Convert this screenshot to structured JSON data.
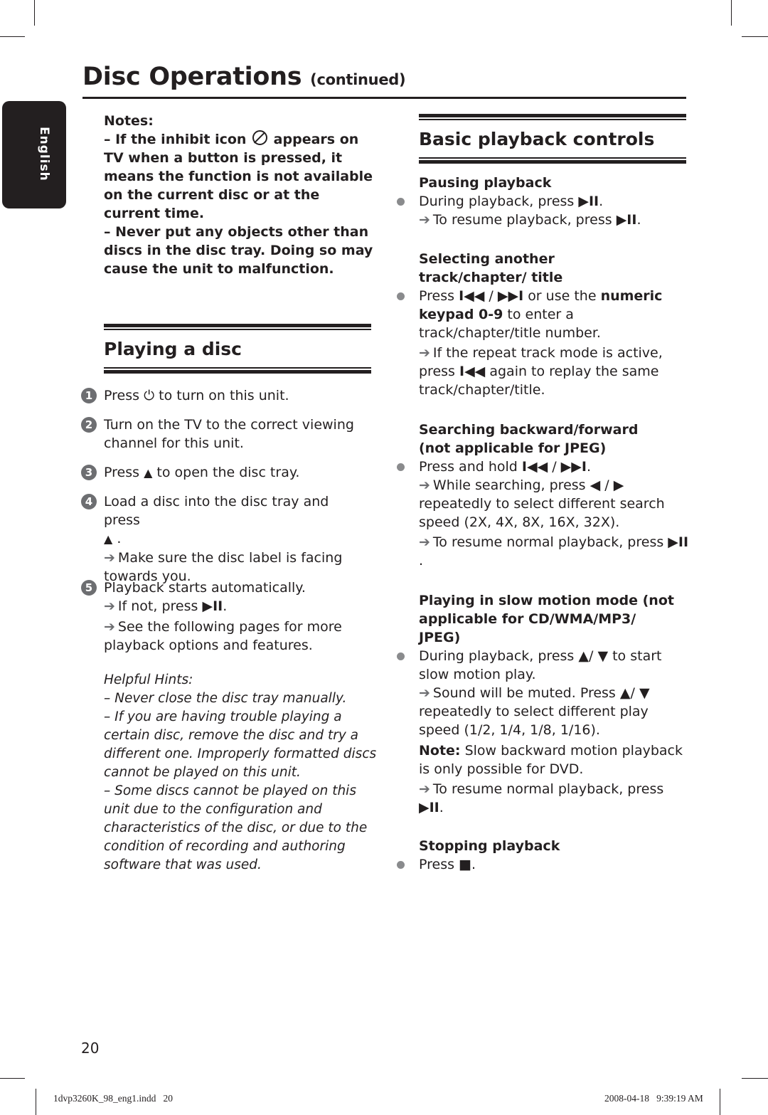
{
  "header": {
    "title": "Disc Operations",
    "title_suffix": "(continued)",
    "language_tab": "English"
  },
  "notes": {
    "label": "Notes:",
    "items": [
      {
        "prefix": "–  If the inhibit icon",
        "icon": "inhibit-icon",
        "suffix": "appears on TV when a button is pressed, it means the function is not available on the current disc or at the current time."
      },
      {
        "text": "–  Never put any objects other than discs in the disc tray.  Doing so may cause the unit to malfunction."
      }
    ]
  },
  "playing_disc": {
    "title": "Playing a disc",
    "steps": [
      {
        "num": "1",
        "before": "Press",
        "icon": "power-icon",
        "after": "to turn on this unit."
      },
      {
        "num": "2",
        "text": "Turn on the TV to the correct viewing channel for this unit."
      },
      {
        "num": "3",
        "before": "Press",
        "icon": "eject-icon",
        "after": "to open the disc tray."
      },
      {
        "num": "4",
        "text": "Load a disc into the disc tray and press",
        "icon": "eject-icon",
        "sub": [
          "Make sure the disc label is facing towards you."
        ]
      },
      {
        "num": "5",
        "text": "Playback starts automatically.",
        "sub": [
          "If not, press",
          "See the following pages for more playback options and features."
        ]
      }
    ],
    "hints": {
      "label": "Helpful Hints:",
      "items": [
        "–  Never close the disc tray manually.",
        "–  If you are having trouble playing a certain disc, remove the disc and try a different one. Improperly formatted discs cannot be played on this unit.",
        "–  Some discs cannot be played on this unit due to the configuration and characteristics of the disc, or due to the condition of recording and authoring software that was used."
      ]
    }
  },
  "basic_controls": {
    "title": "Basic playback controls",
    "glyphs": {
      "play_pause": "▶II",
      "prev": "I◀◀",
      "next": "▶▶I",
      "left": "◀",
      "right": "▶",
      "up": "▲",
      "down": "▼",
      "stop": "■",
      "eject": "⏏",
      "power": "⏻",
      "arrow": "➔"
    },
    "pausing": {
      "heading": "Pausing playback",
      "bullet": "During playback, press",
      "sub": "To resume playback, press"
    },
    "selecting": {
      "heading": "Selecting another track/chapter/ title",
      "bullet_a": "Press",
      "bullet_b": "or use the",
      "bullet_bold": "numeric keypad 0-9",
      "bullet_c": "to enter a track/chapter/title number.",
      "sub_a": "If the repeat track mode is active, press",
      "sub_b": "again to replay the same track/chapter/title."
    },
    "searching": {
      "heading": "Searching backward/forward (not applicable for JPEG)",
      "bullet": "Press and hold",
      "sub1_a": "While searching, press",
      "sub1_b": "repeatedly to select different search speed (2X, 4X, 8X, 16X, 32X).",
      "sub2": "To resume normal playback, press"
    },
    "slow": {
      "heading": "Playing in slow motion mode (not applicable for CD/WMA/MP3/ JPEG)",
      "bullet_a": "During playback, press",
      "bullet_b": "to start slow motion play.",
      "sub1_a": "Sound will be muted. Press",
      "sub1_b": "repeatedly to select different play speed (1/2, 1/4, 1/8, 1/16).",
      "note_label": "Note:",
      "note_text": "Slow backward motion playback is only possible for DVD.",
      "sub2": "To resume normal playback, press"
    },
    "stopping": {
      "heading": "Stopping playback",
      "bullet": "Press"
    }
  },
  "page_number": "20",
  "footer": {
    "file": "1dvp3260K_98_eng1.indd   20",
    "timestamp": "2008-04-18   9:39:19 AM"
  }
}
